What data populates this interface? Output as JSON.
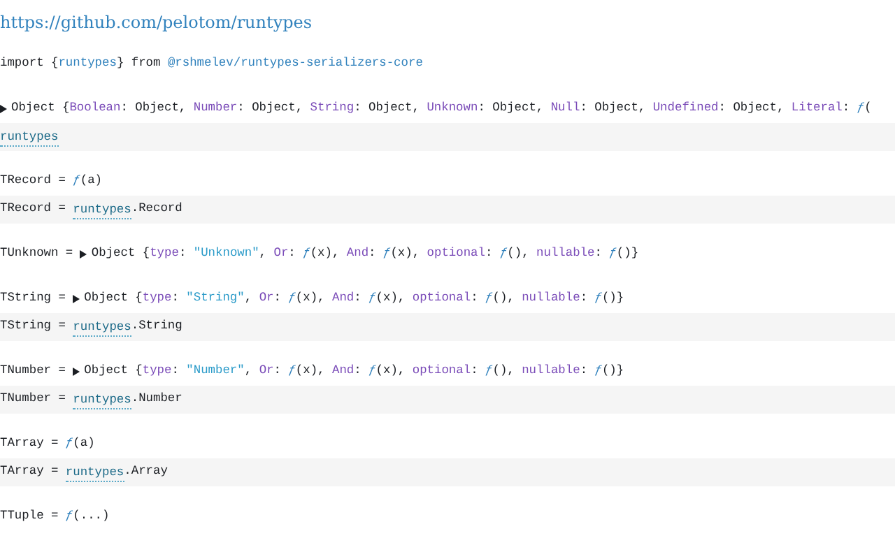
{
  "link": "https://github.com/pelotom/runtypes",
  "cells": [
    {
      "output": [
        {
          "kind": "text",
          "s": "import {"
        },
        {
          "kind": "name",
          "s": "runtypes"
        },
        {
          "kind": "text",
          "s": "} from "
        },
        {
          "kind": "link",
          "s": "@rshmelev/runtypes-serializers-core"
        }
      ]
    },
    {
      "output": [
        {
          "kind": "toggle"
        },
        {
          "kind": "text",
          "s": "Object {"
        },
        {
          "kind": "key",
          "s": "Boolean"
        },
        {
          "kind": "text",
          "s": ": Object, "
        },
        {
          "kind": "key",
          "s": "Number"
        },
        {
          "kind": "text",
          "s": ": Object, "
        },
        {
          "kind": "key",
          "s": "String"
        },
        {
          "kind": "text",
          "s": ": Object, "
        },
        {
          "kind": "key",
          "s": "Unknown"
        },
        {
          "kind": "text",
          "s": ": Object, "
        },
        {
          "kind": "key",
          "s": "Null"
        },
        {
          "kind": "text",
          "s": ": Object, "
        },
        {
          "kind": "key",
          "s": "Undefined"
        },
        {
          "kind": "text",
          "s": ": Object, "
        },
        {
          "kind": "key",
          "s": "Literal"
        },
        {
          "kind": "text",
          "s": ": "
        },
        {
          "kind": "fn",
          "s": "ƒ"
        },
        {
          "kind": "text",
          "s": "("
        }
      ],
      "source": [
        {
          "kind": "ref",
          "s": "runtypes"
        }
      ]
    },
    {
      "output": [
        {
          "kind": "text",
          "s": "TRecord = "
        },
        {
          "kind": "fn",
          "s": "ƒ"
        },
        {
          "kind": "text",
          "s": "(a)"
        }
      ],
      "source": [
        {
          "kind": "text",
          "s": "TRecord = "
        },
        {
          "kind": "ref",
          "s": "runtypes"
        },
        {
          "kind": "text",
          "s": ".Record"
        }
      ]
    },
    {
      "output": [
        {
          "kind": "text",
          "s": "TUnknown = "
        },
        {
          "kind": "toggle"
        },
        {
          "kind": "text",
          "s": "Object {"
        },
        {
          "kind": "key",
          "s": "type"
        },
        {
          "kind": "text",
          "s": ": "
        },
        {
          "kind": "string",
          "s": "\"Unknown\""
        },
        {
          "kind": "text",
          "s": ", "
        },
        {
          "kind": "key",
          "s": "Or"
        },
        {
          "kind": "text",
          "s": ": "
        },
        {
          "kind": "fn",
          "s": "ƒ"
        },
        {
          "kind": "text",
          "s": "(x), "
        },
        {
          "kind": "key",
          "s": "And"
        },
        {
          "kind": "text",
          "s": ": "
        },
        {
          "kind": "fn",
          "s": "ƒ"
        },
        {
          "kind": "text",
          "s": "(x), "
        },
        {
          "kind": "key",
          "s": "optional"
        },
        {
          "kind": "text",
          "s": ": "
        },
        {
          "kind": "fn",
          "s": "ƒ"
        },
        {
          "kind": "text",
          "s": "(), "
        },
        {
          "kind": "key",
          "s": "nullable"
        },
        {
          "kind": "text",
          "s": ": "
        },
        {
          "kind": "fn",
          "s": "ƒ"
        },
        {
          "kind": "text",
          "s": "()}"
        }
      ]
    },
    {
      "output": [
        {
          "kind": "text",
          "s": "TString = "
        },
        {
          "kind": "toggle"
        },
        {
          "kind": "text",
          "s": "Object {"
        },
        {
          "kind": "key",
          "s": "type"
        },
        {
          "kind": "text",
          "s": ": "
        },
        {
          "kind": "string",
          "s": "\"String\""
        },
        {
          "kind": "text",
          "s": ", "
        },
        {
          "kind": "key",
          "s": "Or"
        },
        {
          "kind": "text",
          "s": ": "
        },
        {
          "kind": "fn",
          "s": "ƒ"
        },
        {
          "kind": "text",
          "s": "(x), "
        },
        {
          "kind": "key",
          "s": "And"
        },
        {
          "kind": "text",
          "s": ": "
        },
        {
          "kind": "fn",
          "s": "ƒ"
        },
        {
          "kind": "text",
          "s": "(x), "
        },
        {
          "kind": "key",
          "s": "optional"
        },
        {
          "kind": "text",
          "s": ": "
        },
        {
          "kind": "fn",
          "s": "ƒ"
        },
        {
          "kind": "text",
          "s": "(), "
        },
        {
          "kind": "key",
          "s": "nullable"
        },
        {
          "kind": "text",
          "s": ": "
        },
        {
          "kind": "fn",
          "s": "ƒ"
        },
        {
          "kind": "text",
          "s": "()}"
        }
      ],
      "source": [
        {
          "kind": "text",
          "s": "TString = "
        },
        {
          "kind": "ref",
          "s": "runtypes"
        },
        {
          "kind": "text",
          "s": ".String"
        }
      ]
    },
    {
      "output": [
        {
          "kind": "text",
          "s": "TNumber = "
        },
        {
          "kind": "toggle"
        },
        {
          "kind": "text",
          "s": "Object {"
        },
        {
          "kind": "key",
          "s": "type"
        },
        {
          "kind": "text",
          "s": ": "
        },
        {
          "kind": "string",
          "s": "\"Number\""
        },
        {
          "kind": "text",
          "s": ", "
        },
        {
          "kind": "key",
          "s": "Or"
        },
        {
          "kind": "text",
          "s": ": "
        },
        {
          "kind": "fn",
          "s": "ƒ"
        },
        {
          "kind": "text",
          "s": "(x), "
        },
        {
          "kind": "key",
          "s": "And"
        },
        {
          "kind": "text",
          "s": ": "
        },
        {
          "kind": "fn",
          "s": "ƒ"
        },
        {
          "kind": "text",
          "s": "(x), "
        },
        {
          "kind": "key",
          "s": "optional"
        },
        {
          "kind": "text",
          "s": ": "
        },
        {
          "kind": "fn",
          "s": "ƒ"
        },
        {
          "kind": "text",
          "s": "(), "
        },
        {
          "kind": "key",
          "s": "nullable"
        },
        {
          "kind": "text",
          "s": ": "
        },
        {
          "kind": "fn",
          "s": "ƒ"
        },
        {
          "kind": "text",
          "s": "()}"
        }
      ],
      "source": [
        {
          "kind": "text",
          "s": "TNumber = "
        },
        {
          "kind": "ref",
          "s": "runtypes"
        },
        {
          "kind": "text",
          "s": ".Number"
        }
      ]
    },
    {
      "output": [
        {
          "kind": "text",
          "s": "TArray = "
        },
        {
          "kind": "fn",
          "s": "ƒ"
        },
        {
          "kind": "text",
          "s": "(a)"
        }
      ],
      "source": [
        {
          "kind": "text",
          "s": "TArray = "
        },
        {
          "kind": "ref",
          "s": "runtypes"
        },
        {
          "kind": "text",
          "s": ".Array"
        }
      ]
    },
    {
      "output": [
        {
          "kind": "text",
          "s": "TTuple = "
        },
        {
          "kind": "fn",
          "s": "ƒ"
        },
        {
          "kind": "text",
          "s": "(...)"
        }
      ]
    }
  ]
}
